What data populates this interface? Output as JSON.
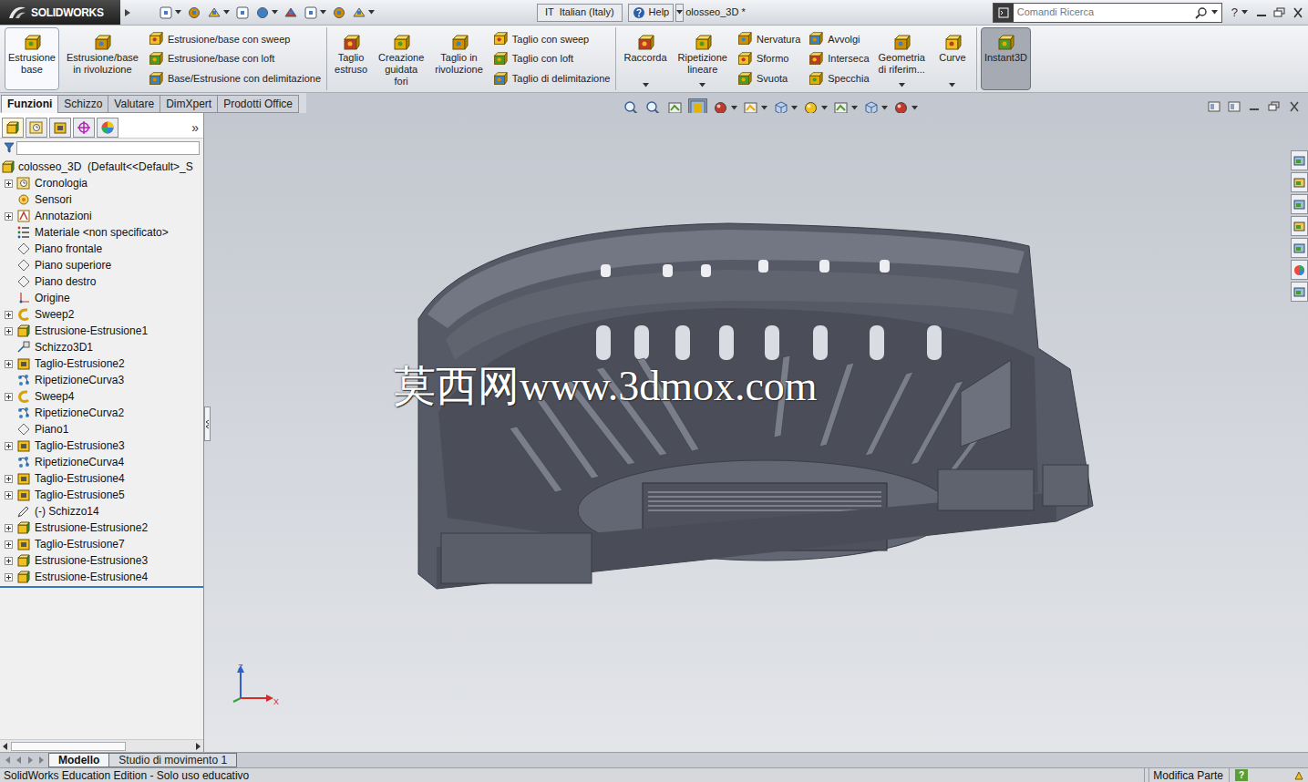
{
  "title_bar": {
    "logo": "SOLIDWORKS",
    "language": "IT  Italian (Italy)",
    "help": "Help",
    "document": "olosseo_3D *",
    "search": {
      "placeholder": "Comandi Ricerca"
    },
    "help_icon": "?"
  },
  "ribbon": {
    "sections": [
      {
        "blocks": [
          {
            "kind": "large",
            "lines": [
              "Estrusione",
              "base"
            ],
            "state": "hover",
            "dropdown": false
          },
          {
            "kind": "large",
            "lines": [
              "Estrusione/base",
              "in rivoluzione"
            ],
            "state": "normal",
            "dropdown": false
          },
          {
            "kind": "column",
            "items": [
              "Estrusione/base con sweep",
              "Estrusione/base con loft",
              "Base/Estrusione con delimitazione"
            ]
          }
        ]
      },
      {
        "blocks": [
          {
            "kind": "large",
            "lines": [
              "Taglio",
              "estruso"
            ],
            "state": "normal",
            "dropdown": false
          },
          {
            "kind": "large",
            "lines": [
              "Creazione",
              "guidata",
              "fori"
            ],
            "state": "normal",
            "dropdown": false
          },
          {
            "kind": "large",
            "lines": [
              "Taglio in",
              "rivoluzione"
            ],
            "state": "normal",
            "dropdown": false
          },
          {
            "kind": "column",
            "items": [
              "Taglio con sweep",
              "Taglio con loft",
              "Taglio di delimitazione"
            ]
          }
        ]
      },
      {
        "blocks": [
          {
            "kind": "large",
            "lines": [
              "Raccorda"
            ],
            "state": "normal",
            "dropdown": true
          },
          {
            "kind": "large",
            "lines": [
              "Ripetizione",
              "lineare"
            ],
            "state": "normal",
            "dropdown": true
          },
          {
            "kind": "column",
            "items": [
              "Nervatura",
              "Sformo",
              "Svuota"
            ]
          },
          {
            "kind": "column",
            "items": [
              "Avvolgi",
              "Interseca",
              "Specchia"
            ]
          },
          {
            "kind": "large",
            "lines": [
              "Geometria",
              "di riferim..."
            ],
            "state": "normal",
            "dropdown": true
          },
          {
            "kind": "large",
            "lines": [
              "Curve"
            ],
            "state": "normal",
            "dropdown": true
          }
        ]
      },
      {
        "blocks": [
          {
            "kind": "large",
            "lines": [
              "Instant3D"
            ],
            "state": "pressed",
            "dropdown": false
          }
        ]
      }
    ]
  },
  "command_tabs": [
    {
      "label": "Funzioni",
      "selected": true
    },
    {
      "label": "Schizzo",
      "selected": false
    },
    {
      "label": "Valutare",
      "selected": false
    },
    {
      "label": "DimXpert",
      "selected": false
    },
    {
      "label": "Prodotti Office",
      "selected": false
    }
  ],
  "feature_manager": {
    "more": "»",
    "root": "colosseo_3D  (Default<<Default>_S",
    "items": [
      {
        "label": "Cronologia",
        "kind": "history",
        "expandable": true
      },
      {
        "label": "Sensori",
        "kind": "sensor",
        "expandable": false
      },
      {
        "label": "Annotazioni",
        "kind": "annotation",
        "expandable": true
      },
      {
        "label": "Materiale <non specificato>",
        "kind": "material",
        "expandable": false
      },
      {
        "label": "Piano frontale",
        "kind": "plane",
        "expandable": false
      },
      {
        "label": "Piano superiore",
        "kind": "plane",
        "expandable": false
      },
      {
        "label": "Piano destro",
        "kind": "plane",
        "expandable": false
      },
      {
        "label": "Origine",
        "kind": "origin",
        "expandable": false
      },
      {
        "label": "Sweep2",
        "kind": "sweep",
        "expandable": true
      },
      {
        "label": "Estrusione-Estrusione1",
        "kind": "extrude",
        "expandable": true
      },
      {
        "label": "Schizzo3D1",
        "kind": "sketch3d",
        "expandable": false
      },
      {
        "label": "Taglio-Estrusione2",
        "kind": "cut",
        "expandable": true
      },
      {
        "label": "RipetizioneCurva3",
        "kind": "pattern",
        "expandable": false
      },
      {
        "label": "Sweep4",
        "kind": "sweep",
        "expandable": true
      },
      {
        "label": "RipetizioneCurva2",
        "kind": "pattern",
        "expandable": false
      },
      {
        "label": "Piano1",
        "kind": "plane",
        "expandable": false
      },
      {
        "label": "Taglio-Estrusione3",
        "kind": "cut",
        "expandable": true
      },
      {
        "label": "RipetizioneCurva4",
        "kind": "pattern",
        "expandable": false
      },
      {
        "label": "Taglio-Estrusione4",
        "kind": "cut",
        "expandable": true
      },
      {
        "label": "Taglio-Estrusione5",
        "kind": "cut",
        "expandable": true
      },
      {
        "label": "(-) Schizzo14",
        "kind": "sketch",
        "expandable": false
      },
      {
        "label": "Estrusione-Estrusione2",
        "kind": "extrude",
        "expandable": true
      },
      {
        "label": "Taglio-Estrusione7",
        "kind": "cut",
        "expandable": true
      },
      {
        "label": "Estrusione-Estrusione3",
        "kind": "extrude",
        "expandable": true
      },
      {
        "label": "Estrusione-Estrusione4",
        "kind": "extrude",
        "expandable": true
      }
    ]
  },
  "viewport": {
    "watermark": "莫西网www.3dmox.com",
    "triad": {
      "z": "Z",
      "x": "X"
    }
  },
  "bottom_tabs": [
    {
      "label": "Modello",
      "selected": true
    },
    {
      "label": "Studio di movimento 1",
      "selected": false
    }
  ],
  "status_bar": {
    "text": "SolidWorks Education Edition - Solo uso educativo",
    "mode": "Modifica Parte",
    "help": "?"
  }
}
